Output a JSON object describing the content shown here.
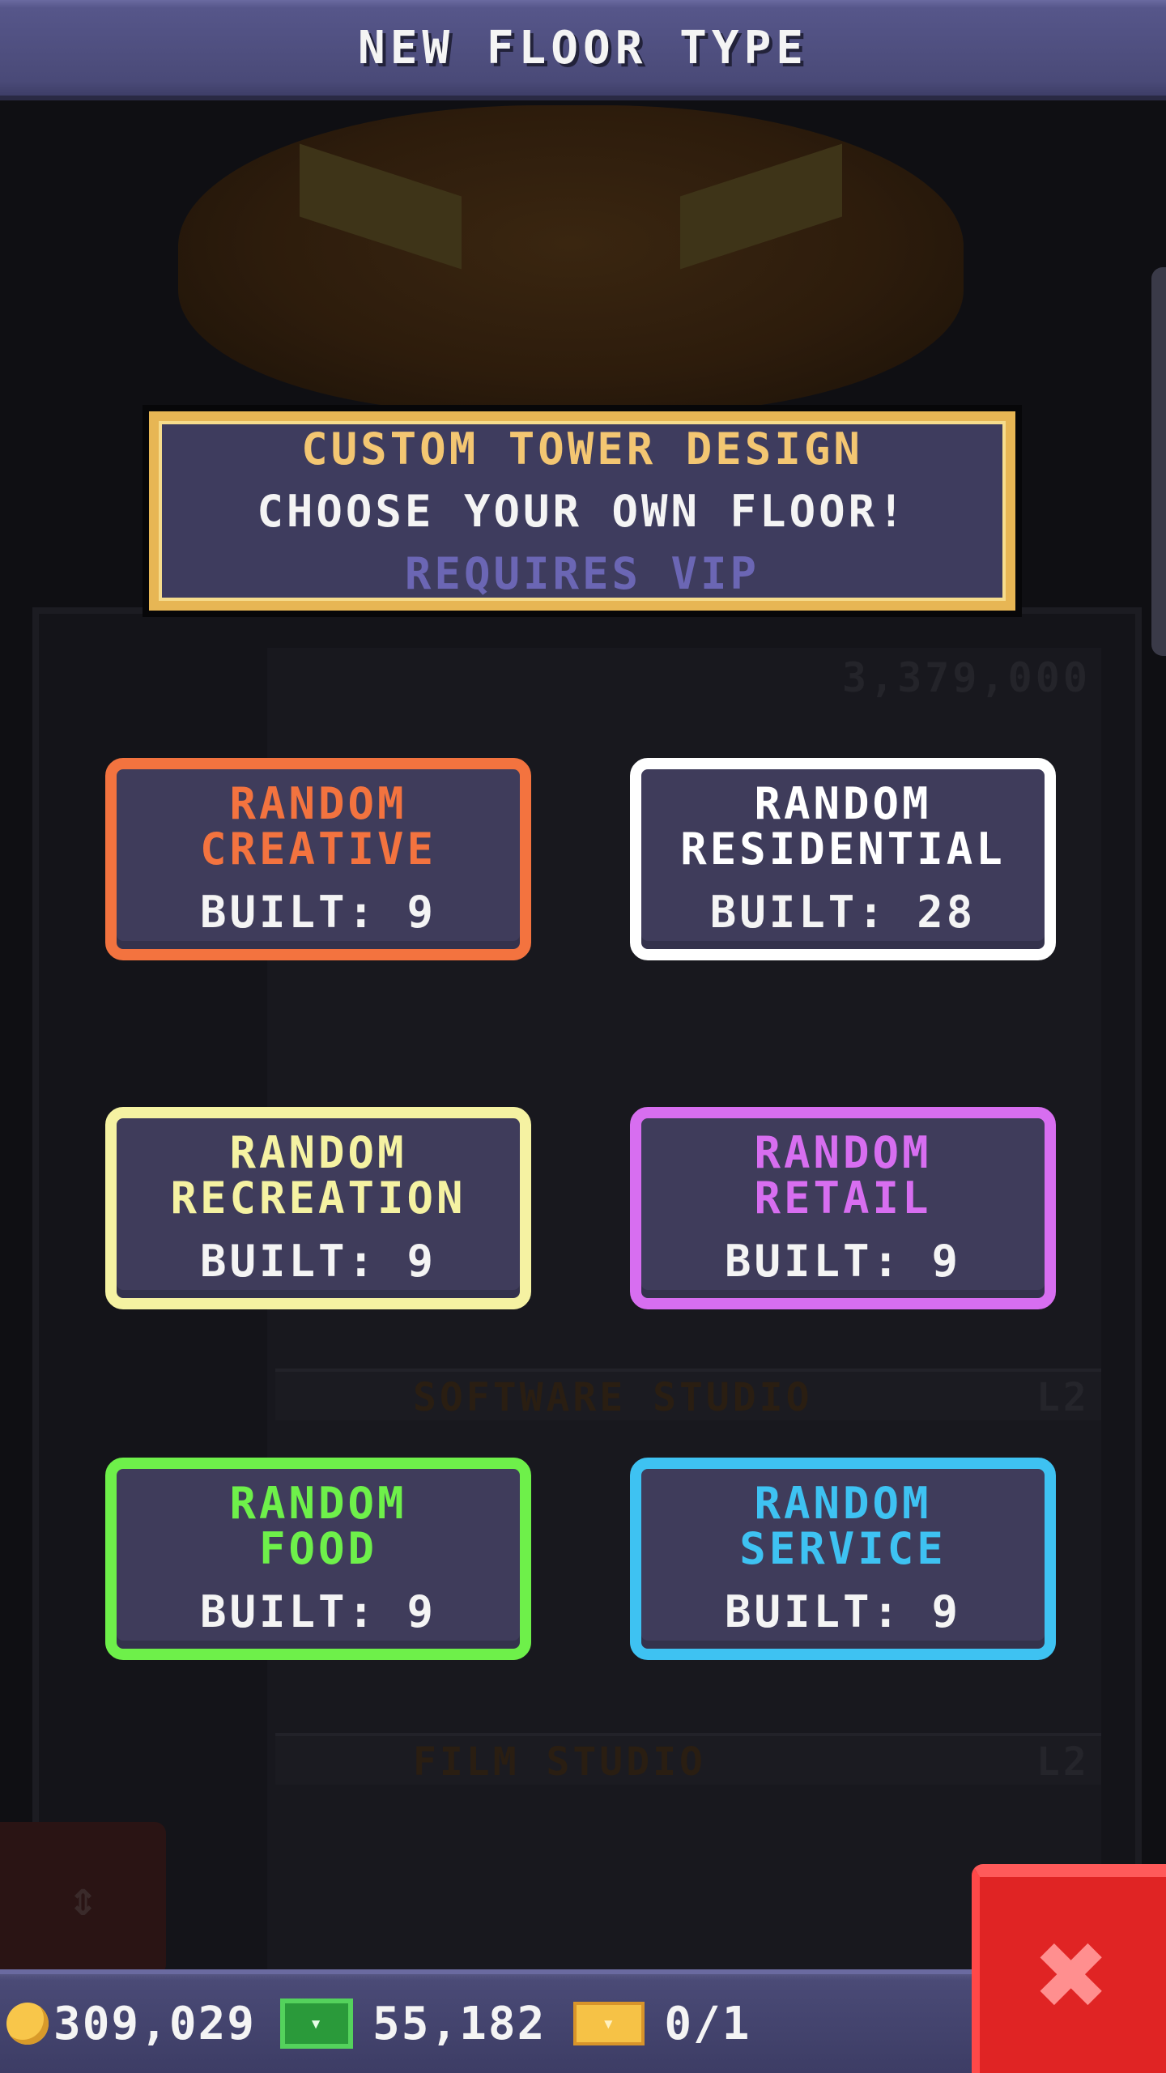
{
  "header": {
    "title": "NEW FLOOR TYPE"
  },
  "vip_banner": {
    "title": "CUSTOM TOWER DESIGN",
    "subtitle": "CHOOSE YOUR OWN FLOOR!",
    "requirement": "REQUIRES VIP"
  },
  "floor_types": [
    {
      "name_line1": "RANDOM",
      "name_line2": "CREATIVE",
      "built": "BUILT: 9",
      "color": "#f3733f"
    },
    {
      "name_line1": "RANDOM",
      "name_line2": "RESIDENTIAL",
      "built": "BUILT: 28",
      "color": "#ffffff"
    },
    {
      "name_line1": "RANDOM",
      "name_line2": "RECREATION",
      "built": "BUILT: 9",
      "color": "#f5f2a2"
    },
    {
      "name_line1": "RANDOM",
      "name_line2": "RETAIL",
      "built": "BUILT: 9",
      "color": "#d76ef0"
    },
    {
      "name_line1": "RANDOM",
      "name_line2": "FOOD",
      "built": "BUILT: 9",
      "color": "#6ef04a"
    },
    {
      "name_line1": "RANDOM",
      "name_line2": "SERVICE",
      "built": "BUILT: 9",
      "color": "#3ec2f2"
    }
  ],
  "background": {
    "coins_display": "3,379,000",
    "floor_1_label": "SOFTWARE STUDIO",
    "floor_1_level": "L2",
    "floor_2_label": "FILM STUDIO",
    "floor_2_level": "L2"
  },
  "footer": {
    "coins": "309,029",
    "bux": "55,182",
    "tickets": "0/1",
    "icons": [
      "coin-icon",
      "cash-icon",
      "ticket-icon"
    ]
  },
  "close_button": {
    "icon": "close-icon"
  },
  "colors": {
    "accent_gold": "#e7b654",
    "close_red": "#e02424",
    "panel": "#3f3c5b"
  }
}
